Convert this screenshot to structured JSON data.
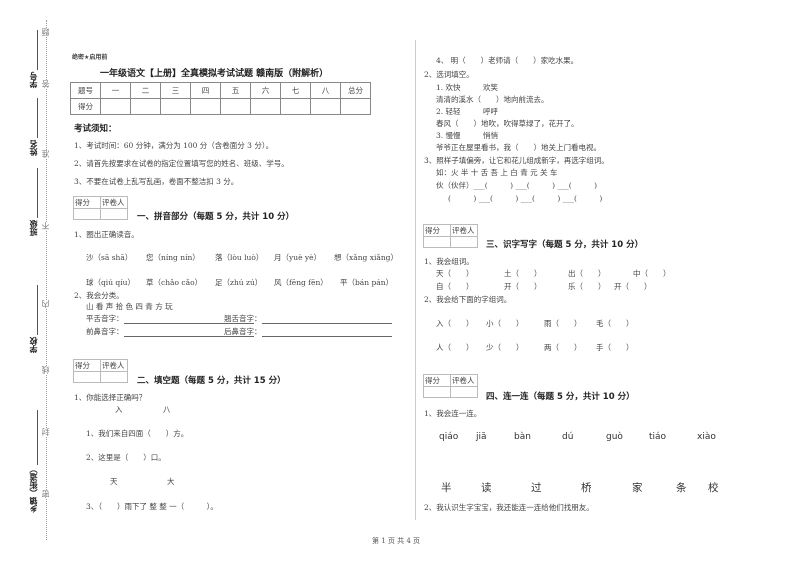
{
  "binding": {
    "labels": [
      "学号",
      "姓名",
      "班级",
      "学校",
      "乡镇（街道）"
    ],
    "dotted_chars": [
      "题",
      "答",
      "准",
      "不",
      "内",
      "线",
      "封",
      "密"
    ]
  },
  "header": {
    "stamp": "绝密★启用前",
    "title": "一年级语文【上册】全真模拟考试试题 赣南版（附解析）"
  },
  "score_table": {
    "row1": [
      "题号",
      "一",
      "二",
      "三",
      "四",
      "五",
      "六",
      "七",
      "八",
      "总分"
    ],
    "row2_label": "得分"
  },
  "notice": {
    "heading": "考试须知：",
    "items": [
      "1、考试时间：60 分钟，满分为 100 分（含卷面分 3 分）。",
      "2、请首先按要求在试卷的指定位置填写您的姓名、班级、学号。",
      "3、不要在试卷上乱写乱画，卷面不整洁扣 3 分。"
    ]
  },
  "grader": {
    "score": "得分",
    "reviewer": "评卷人"
  },
  "section1": {
    "title": "一、拼音部分（每题 5 分，共计 10 分）",
    "q1": "1、圈出正确读音。",
    "row1": [
      "沙（sā shā）",
      "您（níng nín）",
      "落（lòu luò）",
      "月（yuè yè）",
      "想（xǎng  xiǎng）"
    ],
    "row2": [
      "球（qiú qíu）",
      "草（chǎo cǎo）",
      "足（zhú zú）",
      "风（fēng fēn）",
      "平（bán pán）"
    ],
    "q2": "2、我会分类。",
    "chars": "山 看  声 拾  色  四  青  方  玩",
    "ping_she": "平舌音字：",
    "qiao_she": "翘舌音字：",
    "qian_bi": "前鼻音字：",
    "hou_bi": "后鼻音字："
  },
  "section2": {
    "title": "二、填空题（每题 5 分，共计 15 分）",
    "q1": "1、你能选择正确吗？",
    "pair1": [
      "入",
      "八"
    ],
    "s1": "1、我们来自四面（　　）方。",
    "s2": "2、这里是（　　）口。",
    "pair2": [
      "天",
      "大"
    ],
    "s3": "3、（　　）雨下了 整 整 一（　　　）。",
    "s4": "4、 明（　　）老师请（　　）家吃水果。",
    "q2": "2、选词填空。",
    "w1": "1. 欢快　　　欢笑",
    "f1": "清清的溪水（　　）地向前流去。",
    "w2": "2. 轻轻　　　呼呼",
    "f2": "春风（　　）地吹，吹得草绿了，花开了。",
    "w3": "3. 慢慢　　　悄悄",
    "f3": "爷爷正在屋里看书，我（　　）地关上门看电视。",
    "q3": "3、照样子填偏旁，让它和花儿组成新字，再选字组词。",
    "example": "如：火  半    十    舌    吾    上    白    青    元    关    车",
    "r1": "伙（伙伴）___(　　　) ___(　　　) ___(　　　)",
    "r2": "(　　　) ___(　　　) ___(　　　) ___(　　　)"
  },
  "section3": {
    "title": "三、识字写字（每题 5 分，共计 10 分）",
    "q1": "1、我会组词。",
    "row1": [
      "天（　　）",
      "土（　　）",
      "出（　　）",
      "中（　　）"
    ],
    "row2": [
      "自（　　）",
      "开（　　）",
      "乐（　　）",
      "开（　　）"
    ],
    "q2": "2、我会给下面的字组词。",
    "row3": [
      "入（　　）",
      "小（　　）",
      "雨（　　）",
      "毛（　　）"
    ],
    "row4": [
      "人（　　）",
      "少（　　）",
      "两（　　）",
      "手（　　）"
    ]
  },
  "section4": {
    "title": "四、连一连（每题 5 分，共计 10 分）",
    "q1": "1、我会连一连。",
    "pinyin": [
      "qiáo",
      "jiā",
      "bàn",
      "dú",
      "guò",
      "tiáo",
      "xiào"
    ],
    "chars": [
      "半",
      "读",
      "过",
      "桥",
      "家",
      "条",
      "校"
    ],
    "q2": "2、我认识生字宝宝，我还能连一连给他们找朋友。"
  },
  "footer": {
    "page": "第 1 页 共 4 页"
  }
}
